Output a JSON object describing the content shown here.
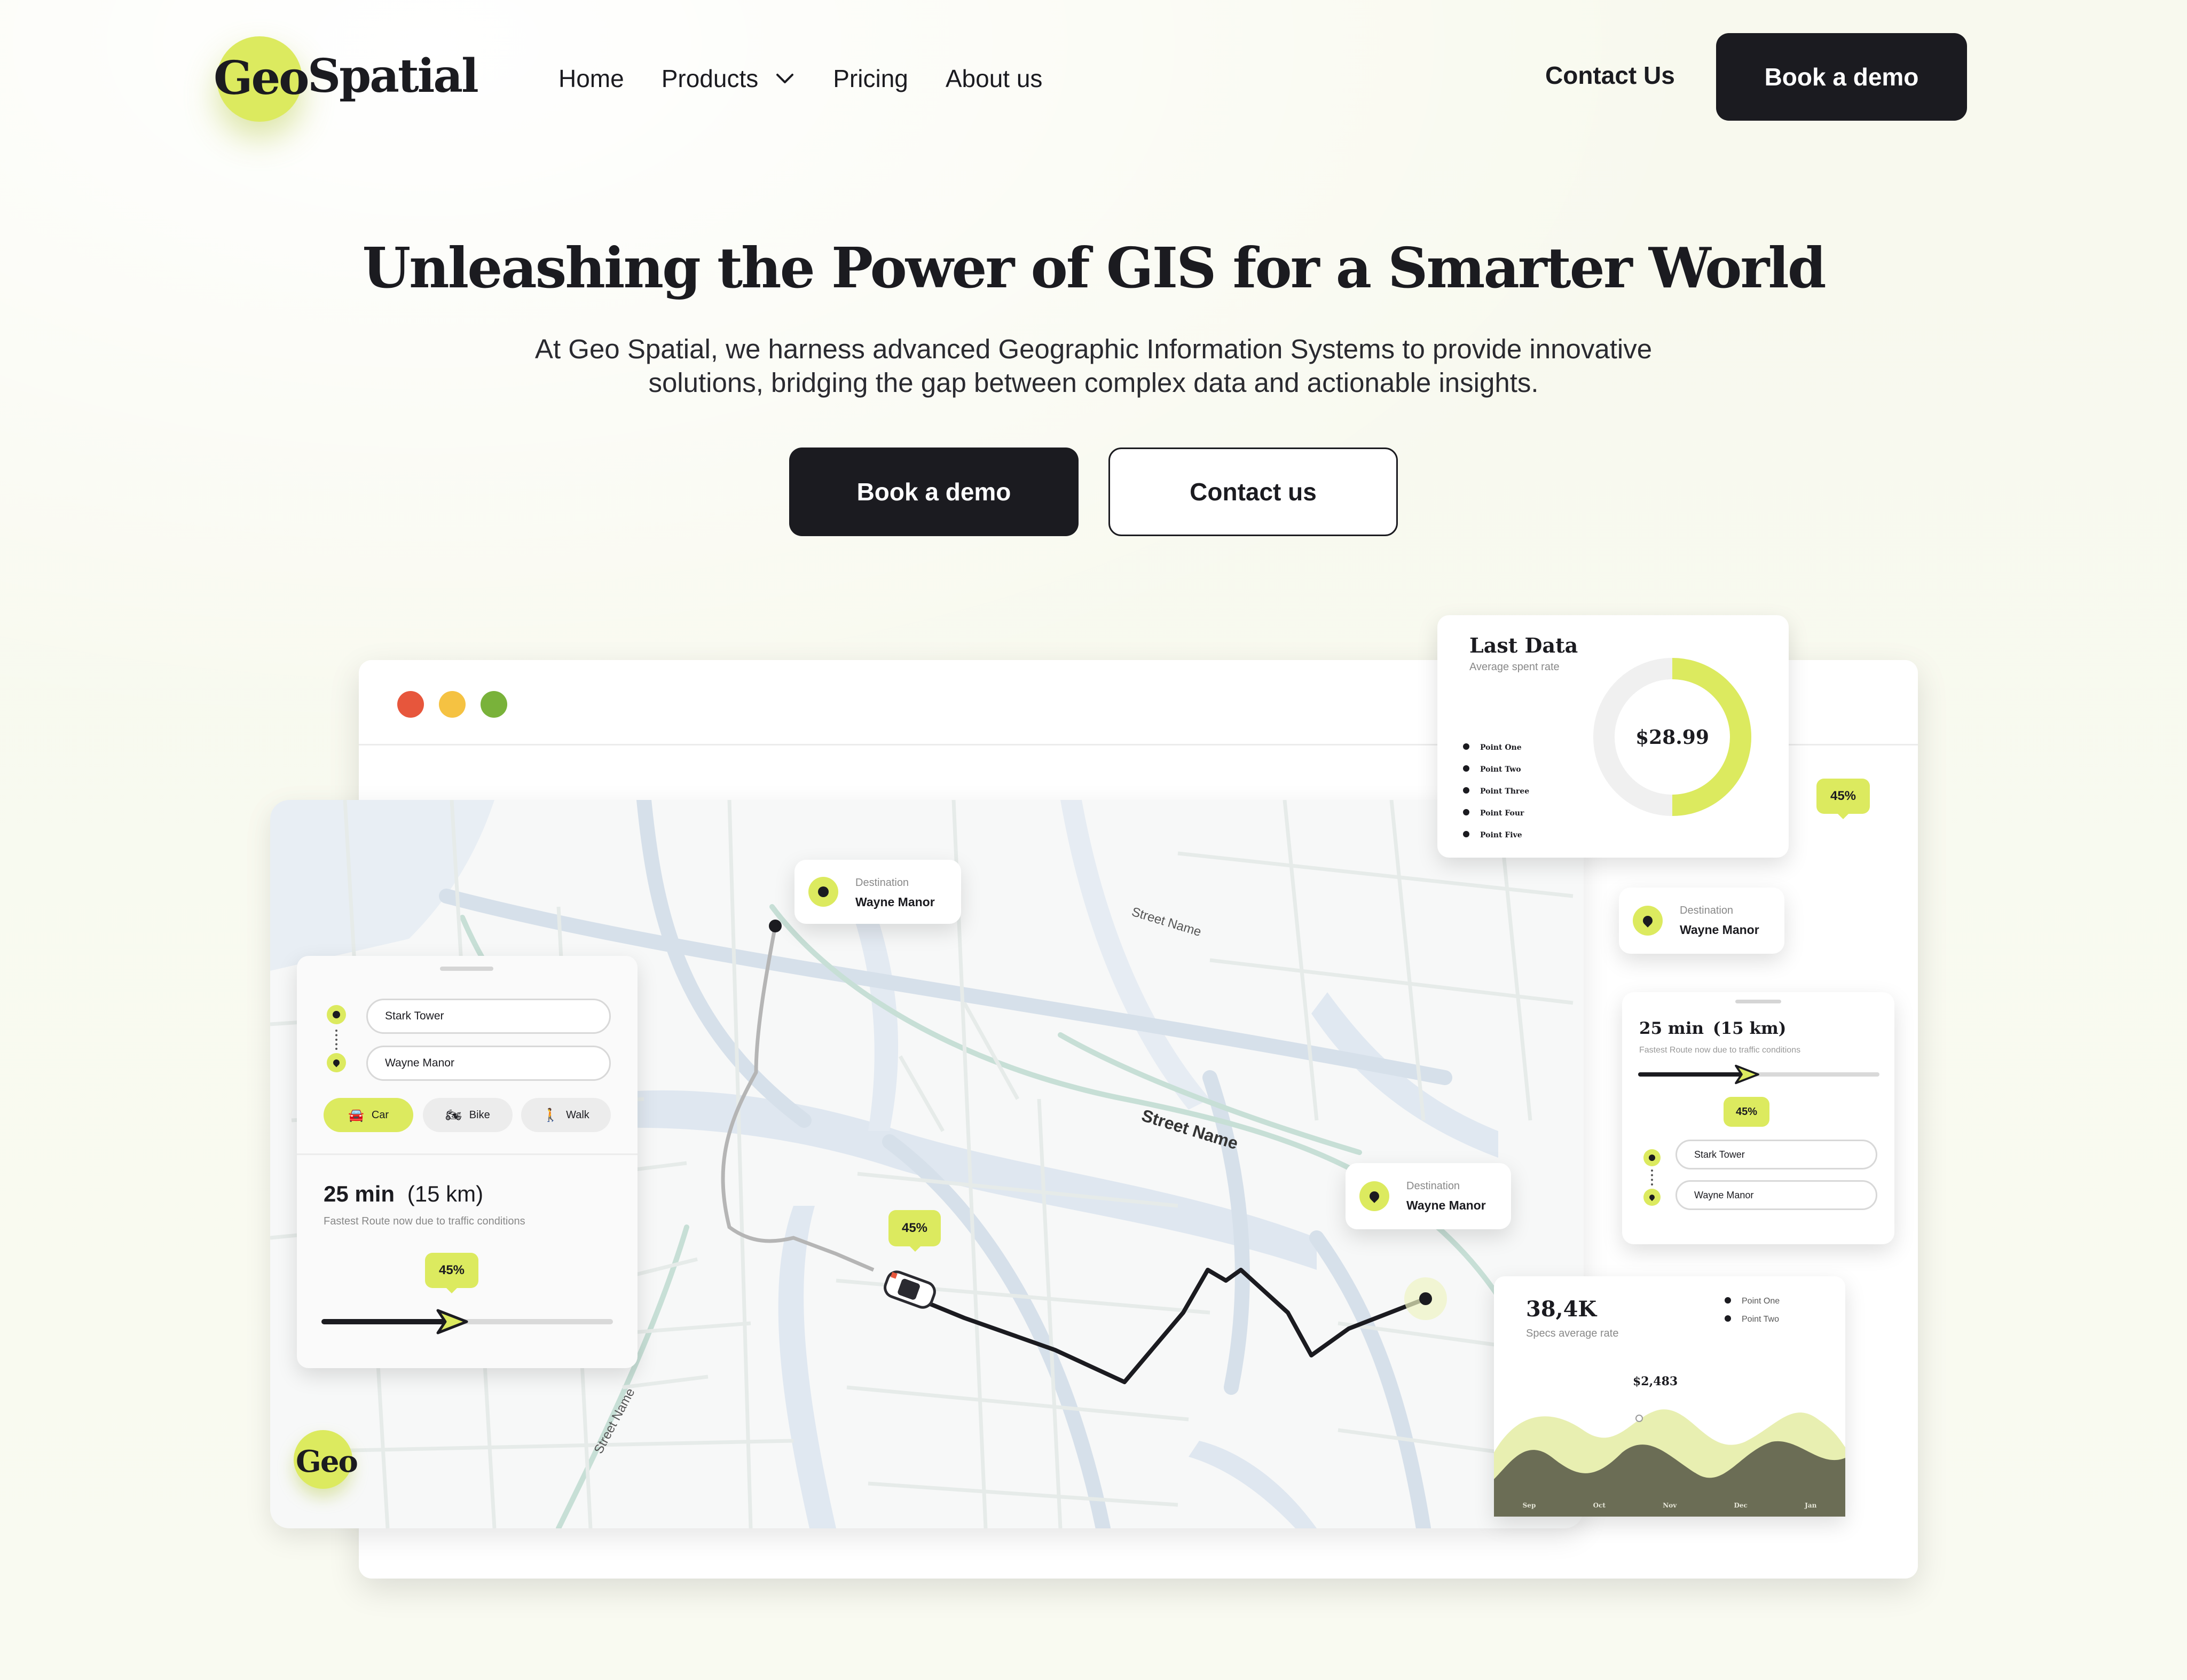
{
  "brand": {
    "logo_left": "Geo",
    "logo_right": "Spatial",
    "accent": "#dcea5f",
    "dark": "#1b1b20"
  },
  "nav": {
    "items": [
      {
        "label": "Home"
      },
      {
        "label": "Products"
      },
      {
        "label": "Pricing"
      },
      {
        "label": "About us"
      }
    ],
    "contact_label": "Contact Us",
    "demo_label": "Book a demo"
  },
  "hero": {
    "title": "Unleashing the Power of GIS for a Smarter World",
    "subtitle_line1": "At Geo Spatial, we harness advanced Geographic Information Systems to provide innovative",
    "subtitle_line2": "solutions, bridging the gap between complex data and actionable insights.",
    "primary_cta": "Book a demo",
    "secondary_cta": "Contact us"
  },
  "mockup": {
    "window_dots": [
      "#e7563c",
      "#f5c242",
      "#79b23a"
    ],
    "map": {
      "street_labels": [
        "Street Name",
        "Street Name",
        "Street Name"
      ],
      "logo": "Geo",
      "progress_badge": "45%",
      "destination_label": "Destination",
      "destination_name": "Wayne Manor"
    },
    "route_card": {
      "from": "Stark Tower",
      "to": "Wayne Manor",
      "modes": [
        {
          "label": "Car",
          "icon": "car-icon",
          "active": true
        },
        {
          "label": "Bike",
          "icon": "motorbike-icon",
          "active": false
        },
        {
          "label": "Walk",
          "icon": "walk-icon",
          "active": false
        }
      ],
      "time": "25 min",
      "distance": "(15 km)",
      "note": "Fastest Route now due to traffic conditions",
      "progress_label": "45%",
      "progress": 0.45
    },
    "last_data": {
      "title": "Last Data",
      "subtitle": "Average spent rate",
      "value": "$28.99",
      "legend": [
        "Point One",
        "Point Two",
        "Point Three",
        "Point Four",
        "Point Five"
      ],
      "fill_fraction": 0.5
    },
    "side_badge": "45%",
    "side_destination": {
      "label": "Destination",
      "name": "Wayne Manor"
    },
    "side_route": {
      "time": "25 min",
      "distance": "(15 km)",
      "note": "Fastest Route now due to traffic conditions",
      "progress_label": "45%",
      "from": "Stark Tower",
      "to": "Wayne Manor",
      "progress": 0.45
    },
    "map_destination": {
      "label": "Destination",
      "name": "Wayne Manor"
    },
    "specs": {
      "value": "38,4K",
      "subtitle": "Specs average rate",
      "legend": [
        "Point One",
        "Point Two"
      ],
      "tooltip": "$2,483",
      "months": [
        "Sep",
        "Oct",
        "Nov",
        "Dec",
        "Jan"
      ]
    }
  }
}
